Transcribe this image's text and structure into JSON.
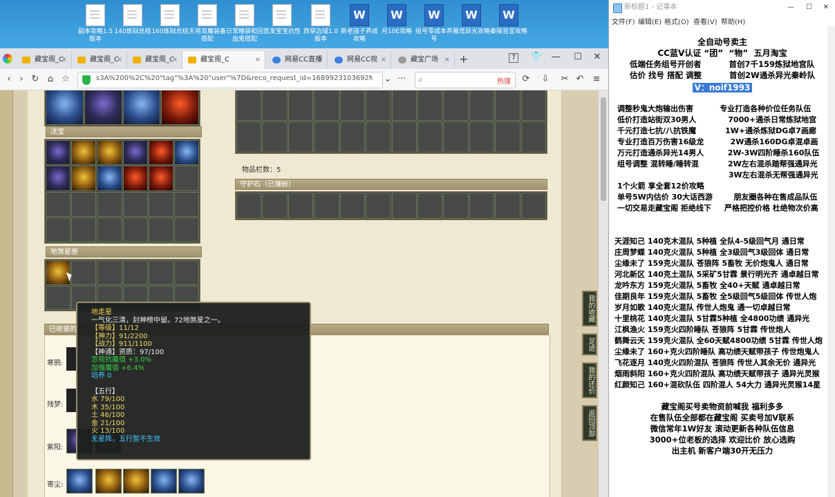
{
  "desktop": {
    "icons": [
      {
        "label": "副本攻略1.5版本",
        "type": "doc"
      },
      {
        "label": "140炼狱总结",
        "type": "doc"
      },
      {
        "label": "160炼狱总结",
        "type": "doc"
      },
      {
        "label": "天将双魔装备搭配",
        "type": "doc"
      },
      {
        "label": "日常睡袋和回血鬼搭配",
        "type": "doc"
      },
      {
        "label": "首发宝宝抗性",
        "type": "doc"
      },
      {
        "label": "西穿边域1.0版本",
        "type": "doc"
      },
      {
        "label": "新老孩子养成攻略",
        "type": "word"
      },
      {
        "label": "月10E攻略",
        "type": "word"
      },
      {
        "label": "组号零成本养号",
        "type": "word"
      },
      {
        "label": "雁塔异光攻略",
        "type": "word"
      },
      {
        "label": "秦陵皆宜攻略",
        "type": "word"
      }
    ]
  },
  "browser": {
    "tabs": [
      {
        "label": "藏宝阁_C",
        "kind": "cbg"
      },
      {
        "label": "藏宝阁_C",
        "kind": "cbg"
      },
      {
        "label": "藏宝阁_C",
        "kind": "cbg"
      },
      {
        "label": "藏宝阁_C",
        "kind": "cbg",
        "active": true
      },
      {
        "label": "网易CC直播",
        "kind": "cc"
      },
      {
        "label": "网易CC视",
        "kind": "cc"
      },
      {
        "label": "藏宝广场",
        "kind": "globe"
      }
    ],
    "tab_count_badge": "7",
    "url": "s3A%200%2C%20\"tag\"%3A%20\"user\"%7D&reco_request_id=1689923103692NGs8Q",
    "search_hot": "热搜"
  },
  "page": {
    "sections": {
      "fabao": "法宝",
      "disha": "地煞星册",
      "shouhu": "守护石（已镶嵌）",
      "collected": "已收录的"
    },
    "item_count_label": "物品栏数：5",
    "collect_rows": [
      "寒鸦:",
      "残梦:",
      "紫阳:",
      "寄尘:"
    ]
  },
  "tooltip": {
    "name": "地走星",
    "desc": "一气化三清，封神榜中留。72地煞星之一。",
    "level": "【等级】11/12",
    "shenli": "【神力】91/2200",
    "zhanli": "【战力】911/1100",
    "shentong": "【神通】资质：97/100",
    "bonus1": "忽视抗魔值 +3.0%",
    "bonus2": "加强魔值 +6.4%",
    "peiyang": "培养 0",
    "wuxing_title": "【五行】",
    "shui": "水 79/100",
    "mu": "木 35/100",
    "tu": "土 46/100",
    "jin": "金 21/100",
    "huo": "火 13/100",
    "note": "无星阵，五行暂不生效"
  },
  "sidetabs": [
    "我的收藏",
    "足迹",
    "我的还价",
    "返回顶部"
  ],
  "notepad": {
    "title": "新标题1 - 记事本",
    "menu": [
      "文件(F)",
      "编辑(E)",
      "格式(O)",
      "查看(V)",
      "帮助(H)"
    ],
    "header_lines": [
      "全自动号卖主",
      "CC蓝V认证 “团”  “物”  五月淘宝",
      "低端任务组号开创者          首创7千159炼狱地宫队",
      "估价 找号 搭配 调整          首创2W通杀异光秦岭队"
    ],
    "contact": "V：noif1993",
    "services": [
      "调整秒鬼大炮输出伤害          专业打造各种价位任务队伍",
      "低价打造站街双30男人            7000+通杀日常炼狱地宫",
      "千元打造七抗/八抗铁魔           1W+通杀炼狱DG卓7画廊",
      "专业打造百万伤害16级龙          2W通杀160DG卓混卓画",
      "万元打造通杀异光14男人         2W-3W四阶睡杀160队伍",
      "组号调整 混转睡/睡转混           2W左右混杀踏帮强通异光",
      "                                          3W左右混杀无帮强通异光"
    ],
    "promo": [
      "1个火箭 享全套12价攻略",
      "单号5W内估价 30大话西游        朋友圈各种在售成品队伍",
      "一切交易走藏宝阁 拒绝线下     严格把控价格 杜绝物次价高"
    ],
    "listings": [
      "天涯知己 140克木混队 5种植 全队4-5级回气月 通日常",
      "庄周梦蝶 140克火混队 5种植 全3级回气3级回体 通日常",
      "尘缘未了 159克火混队 苍狼阵 5畜牧 无价炮鬼人 通日常",
      "河北新区 140克土混队 5采矿5甘霖 景行明光齐 通卓越日常",
      "龙吟东方 159克火混队 5畜牧 全40+天赋 通卓越日常",
      "佳期良年 159克火混队 5畜牧 全5级回气5级回体 传世人炮",
      "岁月如歌 140克火混队 传世人炮鬼 通一切卓越日常",
      "十里桃花 140克火混队 5甘霖5种植 全4800功绩 通异光",
      "江枫渔火 159克火四阶睡队 苍狼阵 5甘霖 传世炮人",
      "鹤舞云天 159克火混队 全60天赋4800功绩 5甘霖 传世人炮",
      "尘缘未了 160+克火四阶睡队 高功绩天赋带孩子 传世炮鬼人",
      "飞花逐月 140克火四阶混队 苍狼阵 传世人其余无价 通异光",
      "烟雨斜阳 160+克火四阶混队 高功绩天赋带孩子 通异光灵猴",
      "红颜知己 160+混砍队伍 四阶混人 54大力 通异光灵猴14星"
    ],
    "footer": [
      "藏宝阁买号卖物资前喊我 福利多多",
      "在售队伍全部都在藏宝阁 买卖号加V联系",
      "微信常年1W好友 滚动更新各种队伍信息",
      "3000+位老板的选择 欢迎比价 放心选购",
      "出主机 新客户端30开无压力"
    ]
  },
  "colors": {
    "desktop_blue": "#3a9edc",
    "tooltip_bg": "#1c201e",
    "tooltip_yellow": "#f3d66a",
    "tooltip_green": "#38d04a",
    "tooltip_cyan": "#3ec6ff",
    "notepad_highlight": "#3b7bd6"
  }
}
